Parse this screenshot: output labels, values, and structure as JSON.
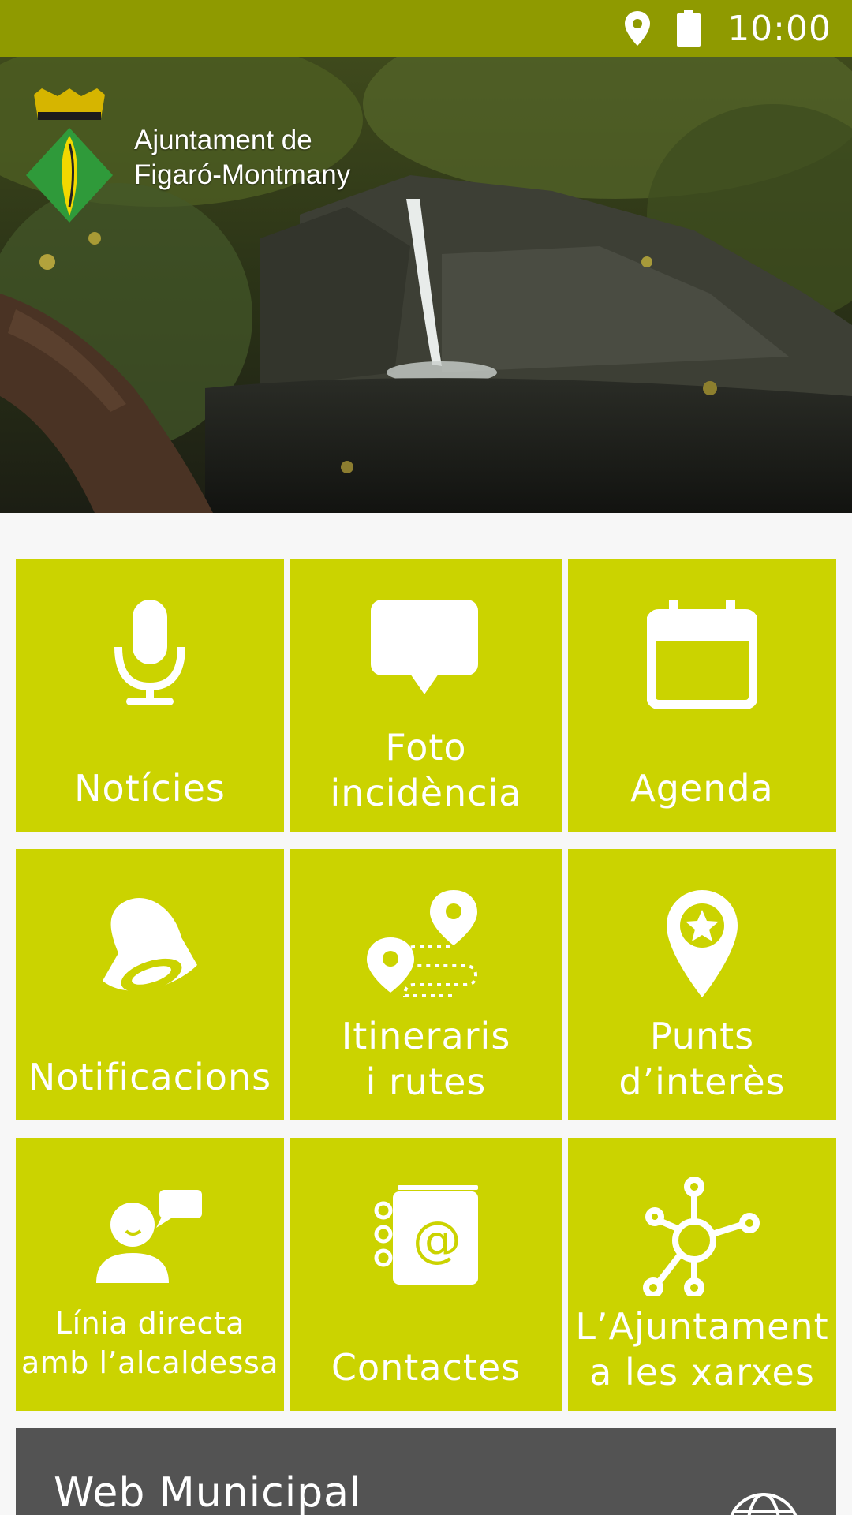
{
  "status_bar": {
    "time": "10:00",
    "icons": [
      "location-pin-icon",
      "battery-icon"
    ]
  },
  "header": {
    "logo_line1": "Ajuntament de",
    "logo_line2": "Figaró-Montmany"
  },
  "colors": {
    "status_bar": "#8f9a00",
    "tile": "#cbd300",
    "web_bar": "#535353",
    "background": "#f7f7f7"
  },
  "tiles": [
    {
      "label": "Notícies",
      "icon": "microphone-icon"
    },
    {
      "label": "Foto\nincidència",
      "icon": "chat-bubble-icon"
    },
    {
      "label": "Agenda",
      "icon": "calendar-icon"
    },
    {
      "label": "Notificacions",
      "icon": "bell-icon"
    },
    {
      "label": "Itineraris\ni rutes",
      "icon": "route-icon"
    },
    {
      "label": "Punts\nd’interès",
      "icon": "star-pin-icon"
    },
    {
      "label": "Línia directa\namb l’alcaldessa",
      "icon": "person-speech-icon"
    },
    {
      "label": "Contactes",
      "icon": "address-book-icon"
    },
    {
      "label": "L’Ajuntament\na les xarxes",
      "icon": "network-icon"
    }
  ],
  "web_bar": {
    "label": "Web Municipal",
    "icon": "globe-www-icon"
  }
}
